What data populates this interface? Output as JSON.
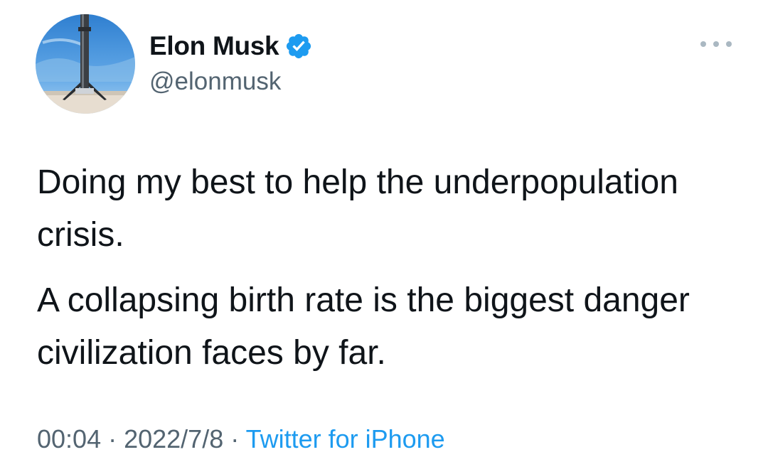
{
  "author": {
    "name": "Elon Musk",
    "handle": "@elonmusk",
    "verified": true,
    "avatar_icon": "rocket-booster-avatar-icon"
  },
  "tweet": {
    "paragraph_1": "Doing my best to help the underpopulation crisis.",
    "paragraph_2": "A collapsing birth rate is the biggest danger civilization faces by far."
  },
  "meta": {
    "time": "00:04",
    "separator": " · ",
    "date": "2022/7/8",
    "source": "Twitter for iPhone"
  },
  "colors": {
    "text": "#0f1419",
    "secondary": "#536471",
    "link": "#1d9bf0",
    "verified_badge": "#1d9bf0",
    "more_dots": "#aab8c2"
  },
  "icons": {
    "verified": "verified-badge-icon",
    "more": "more-options-icon"
  }
}
